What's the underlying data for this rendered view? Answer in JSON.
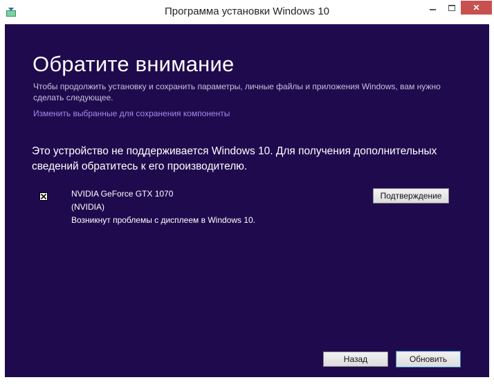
{
  "window": {
    "title": "Программа установки Windows 10",
    "close_glyph": "✕",
    "accent_bg": "#200a4e",
    "close_color": "#c75050"
  },
  "main": {
    "heading": "Обратите внимание",
    "subtext": "Чтобы продолжить установку и сохранить параметры, личные файлы и приложения Windows, вам нужно сделать следующее.",
    "link": "Изменить выбранные для сохранения компоненты",
    "warning": "Это устройство не поддерживается Windows 10. Для получения дополнительных сведений обратитесь к его производителю."
  },
  "device": {
    "icon": "incompatible-icon",
    "name": "NVIDIA GeForce GTX 1070",
    "vendor": "(NVIDIA)",
    "issue": "Возникнут проблемы с дисплеем в Windows 10.",
    "confirm_label": "Подтверждение"
  },
  "footer": {
    "back_label": "Назад",
    "update_label": "Обновить"
  }
}
